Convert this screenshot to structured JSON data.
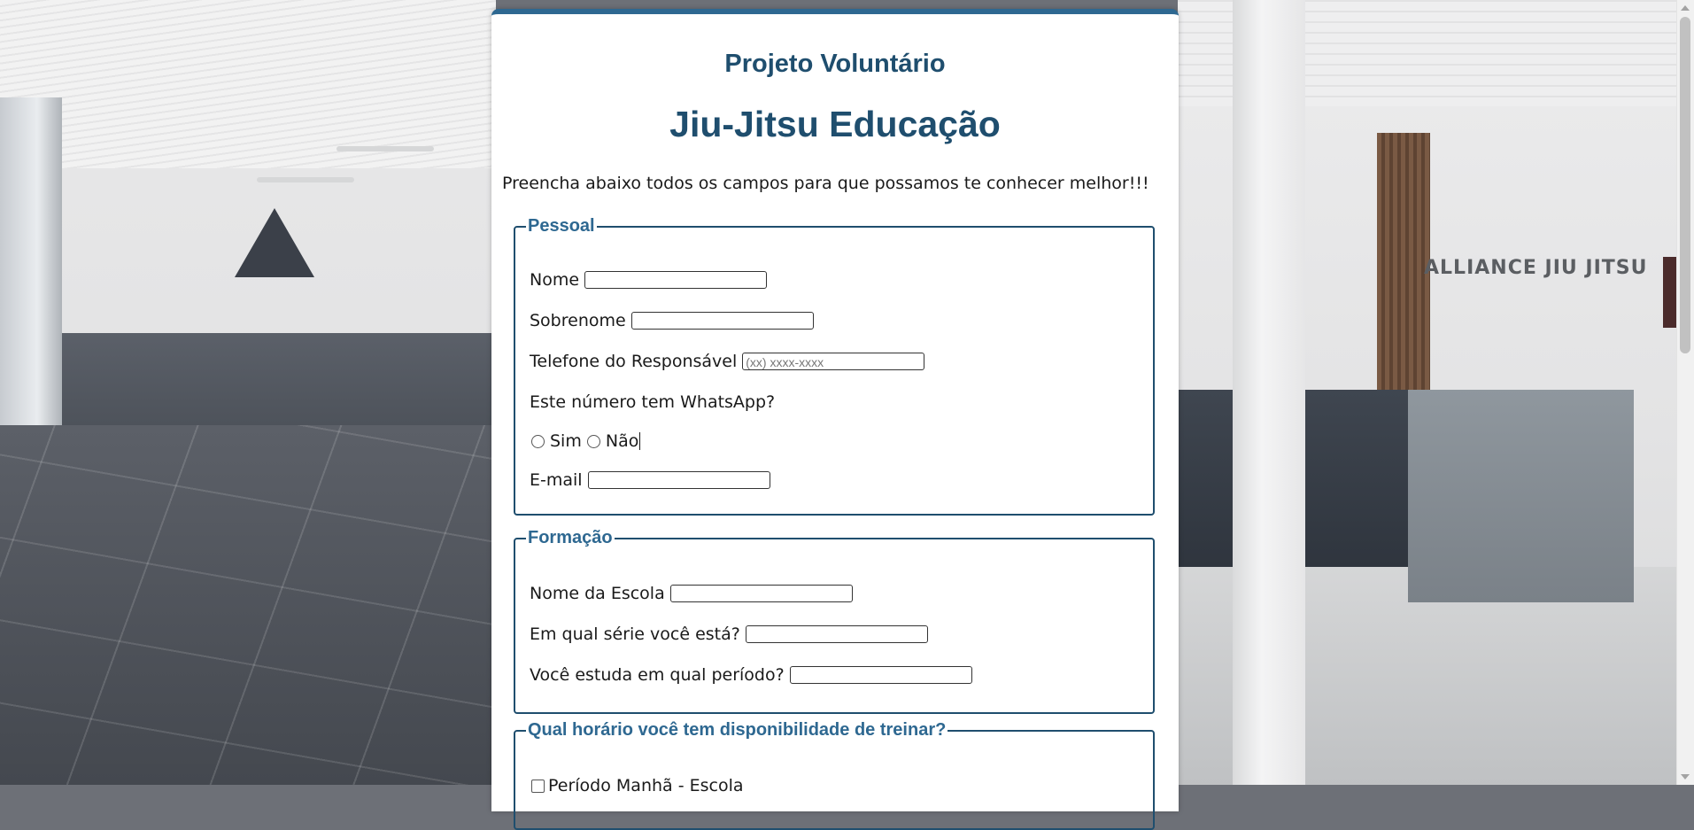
{
  "header": {
    "subtitle": "Projeto Voluntário",
    "title": "Jiu-Jitsu Educação",
    "intro": "Preencha abaixo todos os campos para que possamos te conhecer melhor!!!"
  },
  "background": {
    "sign_text": "ALLIANCE JIU JITSU"
  },
  "pessoal": {
    "legend": "Pessoal",
    "nome_label": "Nome",
    "sobrenome_label": "Sobrenome",
    "telefone_label": "Telefone do Responsável",
    "telefone_placeholder": "(xx) xxxx-xxxx",
    "whatsapp_question": "Este número tem WhatsApp?",
    "whatsapp_options": [
      "Sim",
      "Não"
    ],
    "email_label": "E-mail"
  },
  "formacao": {
    "legend": "Formação",
    "escola_label": "Nome da Escola",
    "serie_label": "Em qual série você está?",
    "periodo_label": "Você estuda em qual período?"
  },
  "horario": {
    "legend": "Qual horário você tem disponibilidade de treinar?",
    "options": [
      "Período Manhã - Escola"
    ]
  },
  "colors": {
    "accent": "#1f4e6e",
    "legend": "#2e6891"
  }
}
